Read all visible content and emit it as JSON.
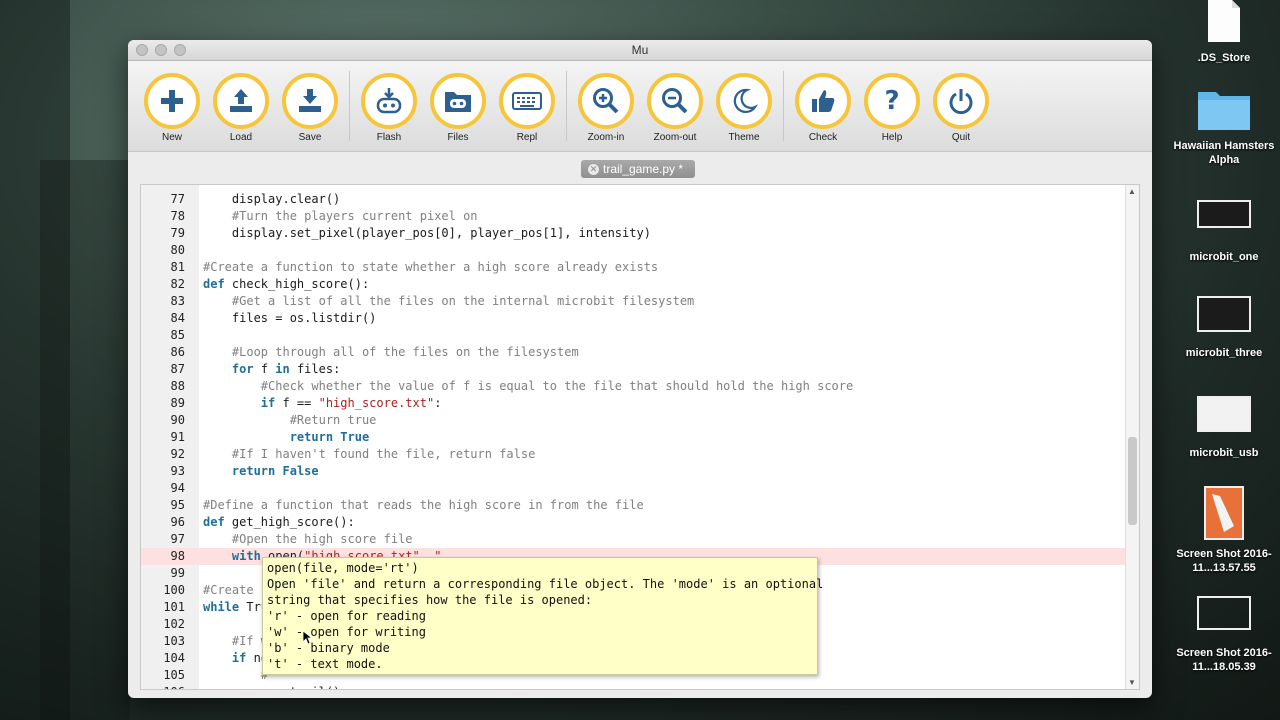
{
  "window": {
    "title": "Mu"
  },
  "toolbar": {
    "buttons": [
      {
        "label": "New",
        "icon": "plus-icon"
      },
      {
        "label": "Load",
        "icon": "upload-icon"
      },
      {
        "label": "Save",
        "icon": "download-icon"
      },
      {
        "label": "Flash",
        "icon": "flash-icon"
      },
      {
        "label": "Files",
        "icon": "files-icon"
      },
      {
        "label": "Repl",
        "icon": "keyboard-icon"
      },
      {
        "label": "Zoom-in",
        "icon": "zoom-in-icon"
      },
      {
        "label": "Zoom-out",
        "icon": "zoom-out-icon"
      },
      {
        "label": "Theme",
        "icon": "moon-icon"
      },
      {
        "label": "Check",
        "icon": "thumbs-up-icon"
      },
      {
        "label": "Help",
        "icon": "question-icon"
      },
      {
        "label": "Quit",
        "icon": "power-icon"
      }
    ]
  },
  "tab": {
    "label": "trail_game.py *"
  },
  "code_lines": [
    {
      "n": "77",
      "text": "    display.clear()"
    },
    {
      "n": "78",
      "text": "    #Turn the players current pixel on"
    },
    {
      "n": "79",
      "text": "    display.set_pixel(player_pos[0], player_pos[1], intensity)"
    },
    {
      "n": "80",
      "text": ""
    },
    {
      "n": "81",
      "text": "#Create a function to state whether a high score already exists"
    },
    {
      "n": "82",
      "text": "def check_high_score():"
    },
    {
      "n": "83",
      "text": "    #Get a list of all the files on the internal microbit filesystem"
    },
    {
      "n": "84",
      "text": "    files = os.listdir()"
    },
    {
      "n": "85",
      "text": ""
    },
    {
      "n": "86",
      "text": "    #Loop through all of the files on the filesystem"
    },
    {
      "n": "87",
      "text": "    for f in files:"
    },
    {
      "n": "88",
      "text": "        #Check whether the value of f is equal to the file that should hold the high score"
    },
    {
      "n": "89",
      "text": "        if f == \"high_score.txt\":"
    },
    {
      "n": "90",
      "text": "            #Return true"
    },
    {
      "n": "91",
      "text": "            return True"
    },
    {
      "n": "92",
      "text": "    #If I haven't found the file, return false"
    },
    {
      "n": "93",
      "text": "    return False"
    },
    {
      "n": "94",
      "text": ""
    },
    {
      "n": "95",
      "text": "#Define a function that reads the high score in from the file"
    },
    {
      "n": "96",
      "text": "def get_high_score():"
    },
    {
      "n": "97",
      "text": "    #Open the high score file"
    },
    {
      "n": "98",
      "text": "    with open(\"high_score.txt\", \""
    },
    {
      "n": "99",
      "text": ""
    },
    {
      "n": "100",
      "text": "#Create f"
    },
    {
      "n": "101",
      "text": "while Tru"
    },
    {
      "n": "102",
      "text": ""
    },
    {
      "n": "103",
      "text": "    #If w"
    },
    {
      "n": "104",
      "text": "    if no"
    },
    {
      "n": "105",
      "text": "        #"
    },
    {
      "n": "106",
      "text": "        gen_trail()"
    }
  ],
  "tooltip": {
    "lines": [
      "open(file, mode='rt')",
      "Open 'file' and return a corresponding file object. The 'mode' is an optional",
      "string that specifies how the file is opened:",
      "'r' - open for reading",
      "'w' - open for writing",
      "'b' - binary mode",
      "'t' - text mode."
    ]
  },
  "desktop": {
    "icons": [
      {
        "label": ".DS_Store",
        "icon": "file-icon"
      },
      {
        "label": "Hawaiian Hamsters Alpha",
        "icon": "folder-icon"
      },
      {
        "label": "microbit_one",
        "icon": "screenshot-icon"
      },
      {
        "label": "microbit_three",
        "icon": "screenshot-icon"
      },
      {
        "label": "microbit_usb",
        "icon": "screenshot-icon"
      },
      {
        "label": "Screen Shot 2016-11...13.57.55",
        "icon": "screenshot-icon"
      },
      {
        "label": "Screen Shot 2016-11...18.05.39",
        "icon": "screenshot-icon"
      }
    ]
  },
  "colors": {
    "accent": "#f6c53a",
    "icon": "#2d5f8f",
    "highlight_line": "#fde0e0",
    "tooltip_bg": "#ffffc8"
  }
}
